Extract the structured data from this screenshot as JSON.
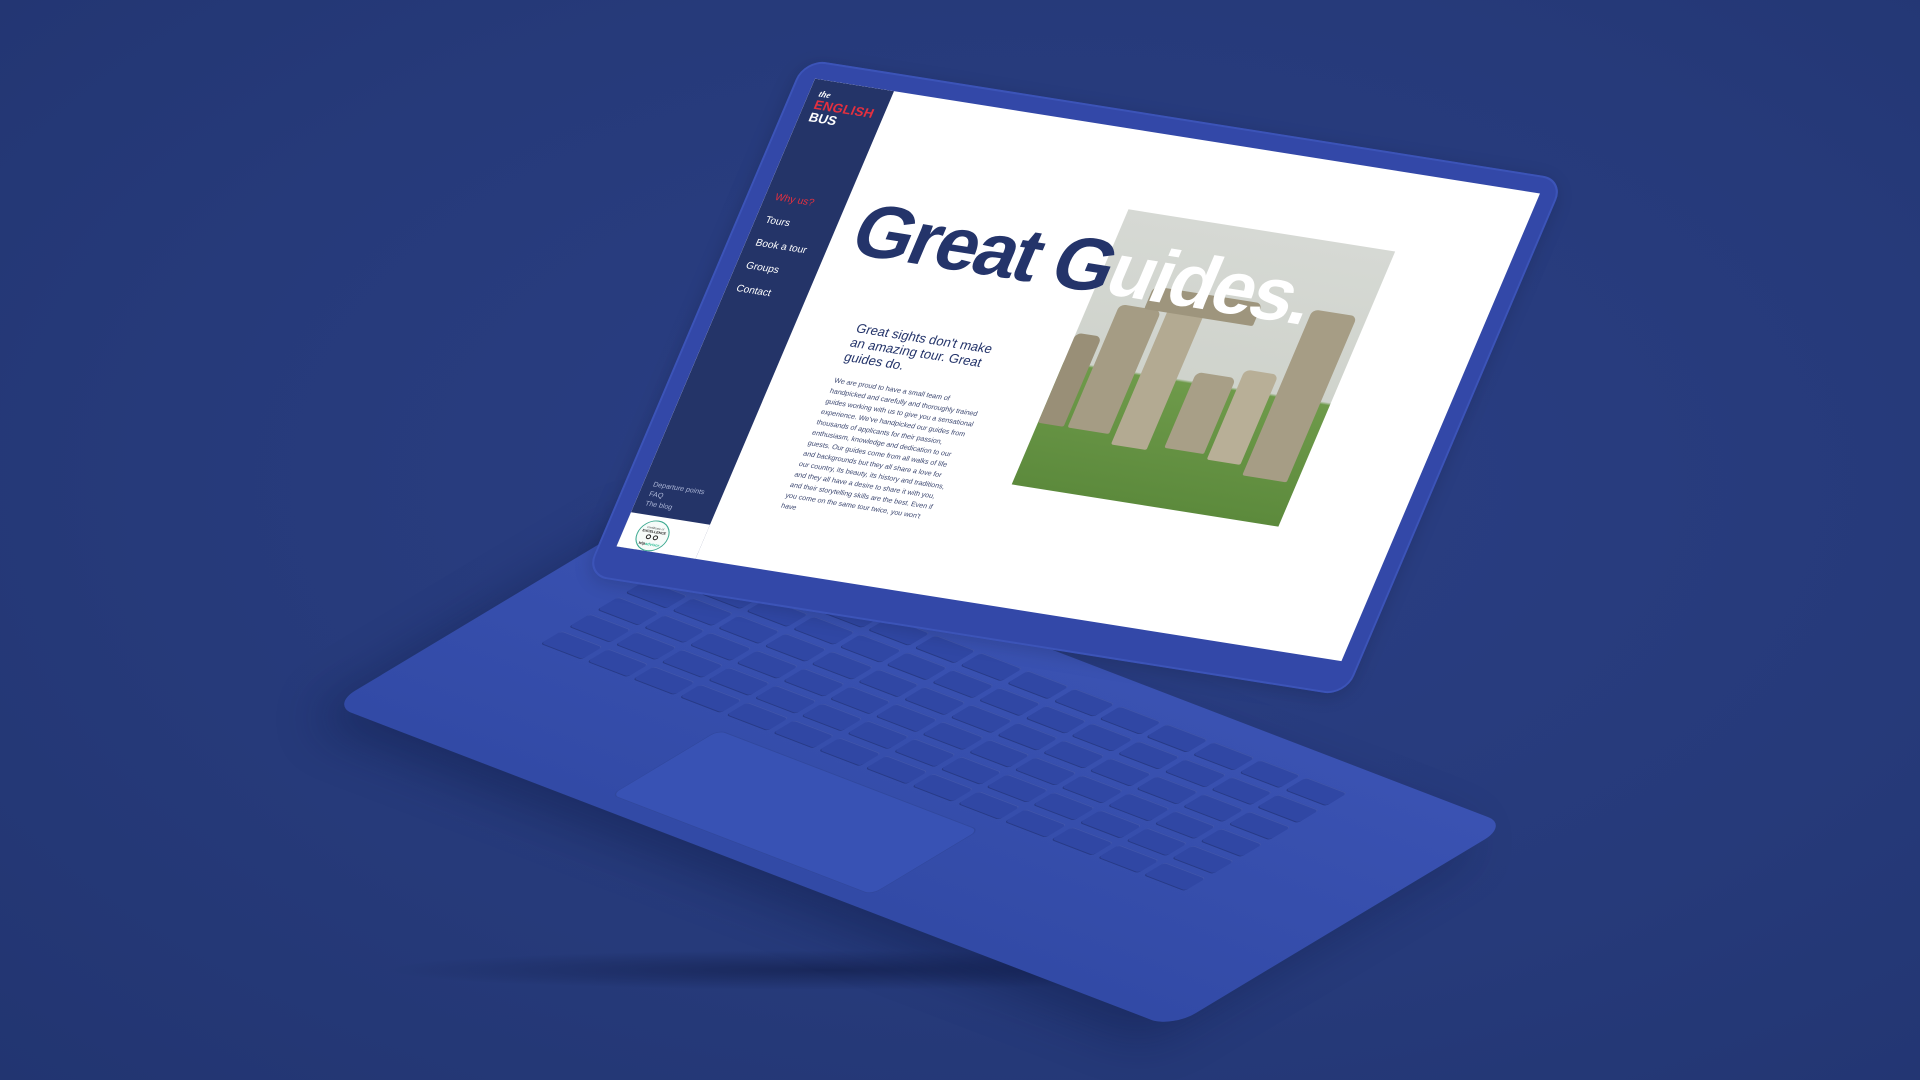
{
  "site": {
    "logo": {
      "the": "the",
      "english": "ENGLISH",
      "bus": "BUS"
    },
    "nav": [
      {
        "label": "Why us?",
        "active": true
      },
      {
        "label": "Tours",
        "active": false
      },
      {
        "label": "Book a tour",
        "active": false
      },
      {
        "label": "Groups",
        "active": false
      },
      {
        "label": "Contact",
        "active": false
      }
    ],
    "subnav": [
      "Departure points",
      "FAQ",
      "The blog"
    ],
    "badge": {
      "certificate": "Certificate of",
      "excellence": "EXCELLENCE",
      "brand_trip": "trip",
      "brand_advisor": "advisor"
    },
    "hero": {
      "headline_part1": "Great",
      "headline_part2_g": "G",
      "headline_part2_rest": "uides.",
      "subheading": "Great sights don't make an amazing tour. Great guides do.",
      "body": "We are proud to have a small team of handpicked and carefully and thoroughly trained guides working with us to give you a sensational experience. We've handpicked our guides from thousands of applicants for their passion, enthusiasm, knowledge and dedication to our guests. Our guides come from all walks of life and backgrounds but they all share a love for our country, its beauty, its history and traditions, and they all have a desire to share it with you, and their storytelling skills are the best. Even if you come on the same tour twice, you won't have"
    },
    "photo": {
      "subject": "stonehenge-photo"
    }
  },
  "colors": {
    "background": "#273a7c",
    "laptop": "#3348a8",
    "navy": "#24346a",
    "accent_red": "#e4303f"
  }
}
